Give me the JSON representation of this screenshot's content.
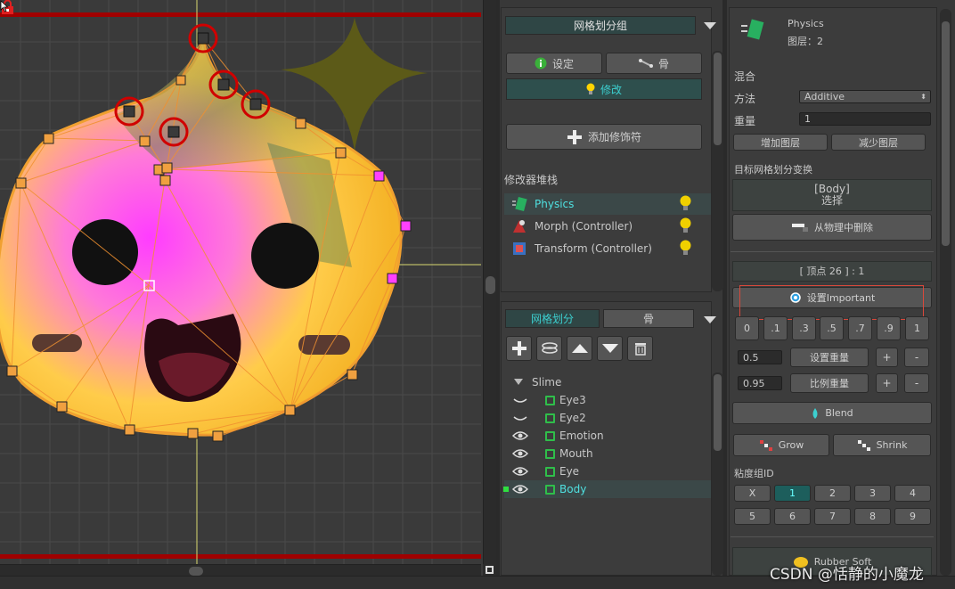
{
  "middle_panel": {
    "top_header": "网格划分组",
    "settings_button": "设定",
    "bone_button": "骨",
    "modify_tab": "修改",
    "add_modifier_button": "添加修饰符",
    "modifier_stack_label": "修改器堆栈",
    "modifiers": [
      {
        "label": "Physics",
        "selected": true
      },
      {
        "label": "Morph (Controller)",
        "selected": false
      },
      {
        "label": "Transform (Controller)",
        "selected": false
      }
    ],
    "mesh_tab": "网格划分",
    "mesh_bone_tab": "骨",
    "tree_root": "Slime",
    "tree_items": [
      {
        "label": "Eye3",
        "visible": false,
        "selected": false
      },
      {
        "label": "Eye2",
        "visible": false,
        "selected": false
      },
      {
        "label": "Emotion",
        "visible": true,
        "selected": false
      },
      {
        "label": "Mouth",
        "visible": true,
        "selected": false
      },
      {
        "label": "Eye",
        "visible": true,
        "selected": false
      },
      {
        "label": "Body",
        "visible": true,
        "selected": true
      }
    ]
  },
  "right_panel": {
    "title": "Physics",
    "layer": "图层：2",
    "blend_section": "混合",
    "method_label": "方法",
    "method_value": "Additive",
    "weight_label": "重量",
    "weight_value": "1",
    "add_layer_button": "增加图层",
    "remove_layer_button": "减少图层",
    "target_mesh_label": "目标网格划分变换",
    "target_box_line1": "[Body]",
    "target_box_line2": "选择",
    "remove_from_physics_button": "从物理中删除",
    "vertex_info": "[ 顶点 26 ] : 1",
    "set_important_button": "设置Important",
    "weight_presets": [
      "0",
      ".1",
      ".3",
      ".5",
      ".7",
      ".9",
      "1"
    ],
    "set_weight_value": "0.5",
    "set_weight_button": "设置重量",
    "scale_weight_value": "0.95",
    "scale_weight_button": "比例重量",
    "plus": "+",
    "minus": "-",
    "blend_button": "Blend",
    "grow_button": "Grow",
    "shrink_button": "Shrink",
    "viscosity_label": "粘度组ID",
    "viscosity_groups_row1": [
      "X",
      "1",
      "2",
      "3",
      "4"
    ],
    "viscosity_groups_row2": [
      "5",
      "6",
      "7",
      "8",
      "9"
    ],
    "bottom_partial_label": "Rubber Soft"
  },
  "watermark": "CSDN @恬静的小魔龙",
  "colors": {
    "accent_teal": "#3ccfcf",
    "selected_row": "#3b4848",
    "highlight_red_box": "#d9483b",
    "vertex_orange": "#f0a040",
    "vertex_magenta": "#ff40ff"
  }
}
